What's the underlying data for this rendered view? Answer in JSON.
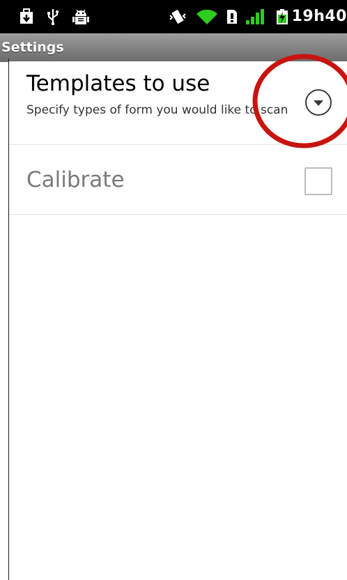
{
  "status_bar": {
    "time": "19h40",
    "icons": [
      "download-icon",
      "usb-icon",
      "android-debug-icon",
      "vibrate-icon",
      "wifi-icon",
      "sim-icon",
      "signal-icon",
      "battery-charging-icon"
    ]
  },
  "title_bar": {
    "title": "Settings"
  },
  "preferences": [
    {
      "title": "Templates to use",
      "summary": "Specify types of form you would like to scan",
      "widget": "dropdown-icon",
      "enabled": true
    },
    {
      "title": "Calibrate",
      "widget": "checkbox",
      "checked": false,
      "enabled": false
    }
  ],
  "annotation": {
    "color": "#c8140e"
  }
}
